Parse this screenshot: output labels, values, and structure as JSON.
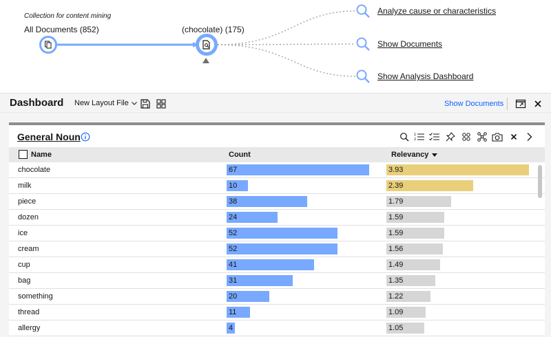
{
  "flow": {
    "collection_caption": "Collection for content mining",
    "start_node_label": "All Documents (852)",
    "current_node_label": "(chocolate) (175)",
    "actions": [
      {
        "label": "Analyze cause or characteristics"
      },
      {
        "label": "Show Documents"
      },
      {
        "label": "Show Analysis Dashboard"
      }
    ]
  },
  "dashboard": {
    "title": "Dashboard",
    "layout_select": "New Layout File",
    "show_documents": "Show Documents"
  },
  "panel": {
    "title": "General Noun",
    "columns": {
      "name": "Name",
      "count": "Count",
      "relevancy": "Relevancy"
    },
    "count_max": 67,
    "relevancy_max": 3.93,
    "rows": [
      {
        "name": "chocolate",
        "count": 67,
        "relevancy": 3.93,
        "highlight": true
      },
      {
        "name": "milk",
        "count": 10,
        "relevancy": 2.39,
        "highlight": true
      },
      {
        "name": "piece",
        "count": 38,
        "relevancy": 1.79,
        "highlight": false
      },
      {
        "name": "dozen",
        "count": 24,
        "relevancy": 1.59,
        "highlight": false
      },
      {
        "name": "ice",
        "count": 52,
        "relevancy": 1.59,
        "highlight": false
      },
      {
        "name": "cream",
        "count": 52,
        "relevancy": 1.56,
        "highlight": false
      },
      {
        "name": "cup",
        "count": 41,
        "relevancy": 1.49,
        "highlight": false
      },
      {
        "name": "bag",
        "count": 31,
        "relevancy": 1.35,
        "highlight": false
      },
      {
        "name": "something",
        "count": 20,
        "relevancy": 1.22,
        "highlight": false
      },
      {
        "name": "thread",
        "count": 11,
        "relevancy": 1.09,
        "highlight": false
      },
      {
        "name": "allergy",
        "count": 4,
        "relevancy": 1.05,
        "highlight": false
      }
    ]
  },
  "colors": {
    "accent": "#78a9ff",
    "link": "#0f62fe",
    "relevancy_high": "#e9cf7a",
    "relevancy_normal": "#d6d6d6"
  }
}
